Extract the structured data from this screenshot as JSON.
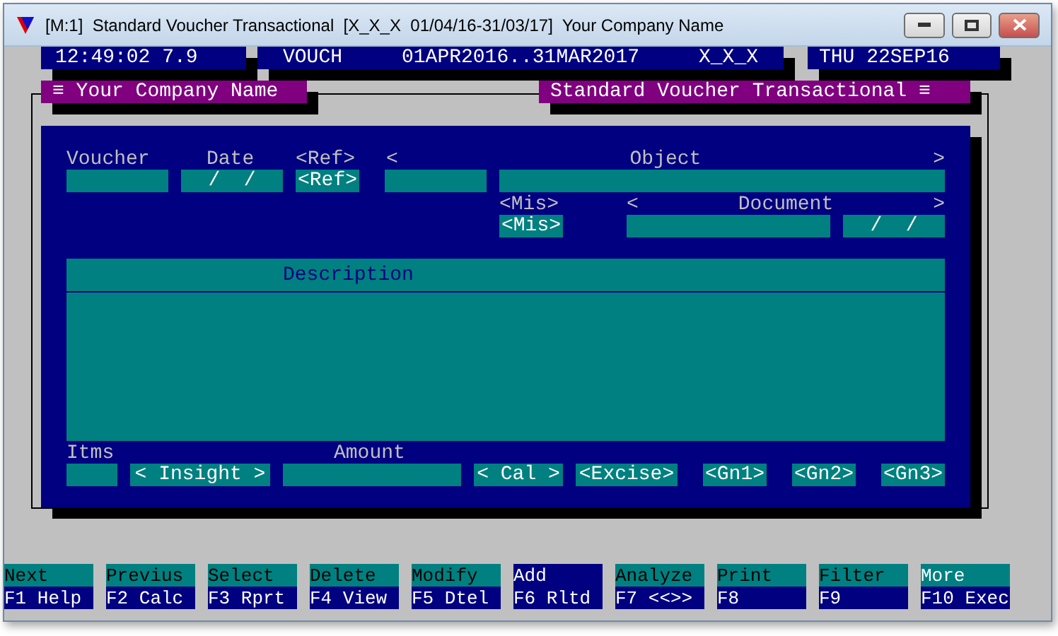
{
  "window": {
    "title": "[M:1]  Standard Voucher Transactional  [X_X_X  01/04/16-31/03/17]  Your Company Name"
  },
  "status_bar": {
    "time": "12:49:02 7.9",
    "module": "VOUCH",
    "period": "01APR2016..31MAR2017",
    "company_code": "X_X_X",
    "date": "THU 22SEP16"
  },
  "frame": {
    "left_title": "≡ Your Company Name",
    "right_title": "Standard Voucher Transactional ≡"
  },
  "form": {
    "voucher_label": "Voucher",
    "date_label": "Date",
    "ref_label": "<Ref>",
    "object_open": "<",
    "object_label": "Object",
    "object_close": ">",
    "date_value": "/  /",
    "ref_button": "<Ref>",
    "mis_label": "<Mis>",
    "document_open": "<",
    "document_label": "Document",
    "document_close": ">",
    "mis_button": "<Mis>",
    "document_date_value": "/  /",
    "description_label": "Description",
    "items_label": "Itms",
    "amount_label": "Amount",
    "buttons": [
      {
        "label": "< Insight >"
      },
      {
        "label": "< Cal >"
      },
      {
        "label": "<Excise>"
      },
      {
        "label": "<Gn1>"
      },
      {
        "label": "<Gn2>"
      },
      {
        "label": "<Gn3>"
      }
    ]
  },
  "function_keys": [
    {
      "action": "Next",
      "key": "F1 Help",
      "selected": false,
      "bright": false
    },
    {
      "action": "Previus",
      "key": "F2 Calc",
      "selected": false,
      "bright": false
    },
    {
      "action": "Select",
      "key": "F3 Rprt",
      "selected": false,
      "bright": false
    },
    {
      "action": "Delete",
      "key": "F4 View",
      "selected": false,
      "bright": false
    },
    {
      "action": "Modify",
      "key": "F5 Dtel",
      "selected": false,
      "bright": false
    },
    {
      "action": "Add",
      "key": "F6 Rltd",
      "selected": true,
      "bright": false
    },
    {
      "action": "Analyze",
      "key": "F7 <<>>",
      "selected": false,
      "bright": false
    },
    {
      "action": "Print",
      "key": "F8",
      "selected": false,
      "bright": false
    },
    {
      "action": "Filter",
      "key": "F9",
      "selected": false,
      "bright": false
    },
    {
      "action": "More",
      "key": "F10 Exec",
      "selected": false,
      "bright": true
    }
  ]
}
